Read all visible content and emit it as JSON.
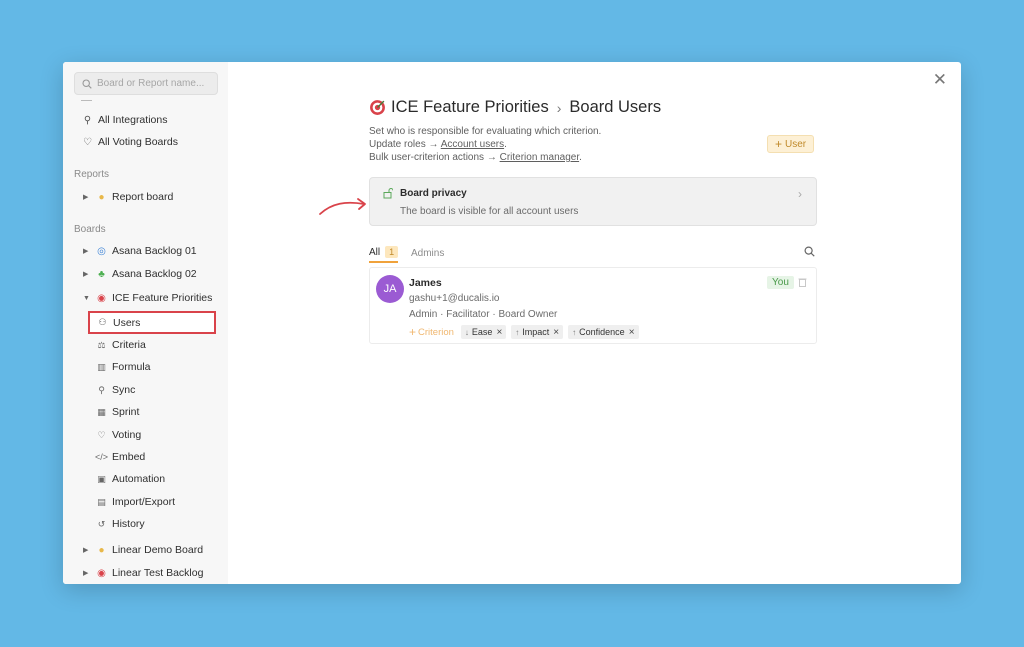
{
  "sidebar": {
    "search_placeholder": "Board or Report name...",
    "top_items": [
      {
        "label": "All Integrations",
        "icon": "plug-icon"
      },
      {
        "label": "All Voting Boards",
        "icon": "bulb-icon"
      }
    ],
    "reports_heading": "Reports",
    "reports": [
      {
        "label": "Report board",
        "icon": "bulb-icon"
      }
    ],
    "boards_heading": "Boards",
    "boards": [
      {
        "label": "Asana Backlog 01",
        "icon": "swirl-icon"
      },
      {
        "label": "Asana Backlog 02",
        "icon": "clover-icon"
      },
      {
        "label": "ICE Feature Priorities",
        "icon": "target-icon"
      }
    ],
    "sub_items": [
      {
        "label": "Users",
        "icon": "users-icon"
      },
      {
        "label": "Criteria",
        "icon": "criteria-icon"
      },
      {
        "label": "Formula",
        "icon": "formula-icon"
      },
      {
        "label": "Sync",
        "icon": "plug-icon"
      },
      {
        "label": "Sprint",
        "icon": "calendar-icon"
      },
      {
        "label": "Voting",
        "icon": "bulb-icon"
      },
      {
        "label": "Embed",
        "icon": "code-icon"
      },
      {
        "label": "Automation",
        "icon": "automation-icon"
      },
      {
        "label": "Import/Export",
        "icon": "csv-icon"
      },
      {
        "label": "History",
        "icon": "history-icon"
      }
    ],
    "more_boards": [
      {
        "label": "Linear Demo Board",
        "icon": "bulb-icon"
      },
      {
        "label": "Linear Test Backlog",
        "icon": "target-icon"
      }
    ]
  },
  "header": {
    "board": "ICE Feature Priorities",
    "separator": "›",
    "page": "Board Users"
  },
  "description": {
    "line1": "Set who is responsible for evaluating which criterion.",
    "line2_prefix": "Update roles → ",
    "line2_link": "Account users",
    "line2_suffix": ".",
    "line3_prefix": "Bulk user-criterion actions → ",
    "line3_link": "Criterion manager",
    "line3_suffix": "."
  },
  "add_user_label": "User",
  "privacy": {
    "title": "Board privacy",
    "subtitle": "The board is visible for all account users"
  },
  "tabs": {
    "all_label": "All",
    "all_count": "1",
    "admins_label": "Admins"
  },
  "user": {
    "initials": "JA",
    "name": "James",
    "email": "gashu+1@ducalis.io",
    "roles": "Admin · Facilitator · Board Owner",
    "you_badge": "You",
    "add_criterion_label": "Criterion",
    "criteria": [
      {
        "label": "Ease",
        "arrow": "↓"
      },
      {
        "label": "Impact",
        "arrow": "↑"
      },
      {
        "label": "Confidence",
        "arrow": "↑"
      }
    ]
  },
  "colors": {
    "background": "#63b8e6",
    "accent": "#f0a23b",
    "highlight_border": "#d9434a",
    "avatar": "#9b5bd3"
  }
}
